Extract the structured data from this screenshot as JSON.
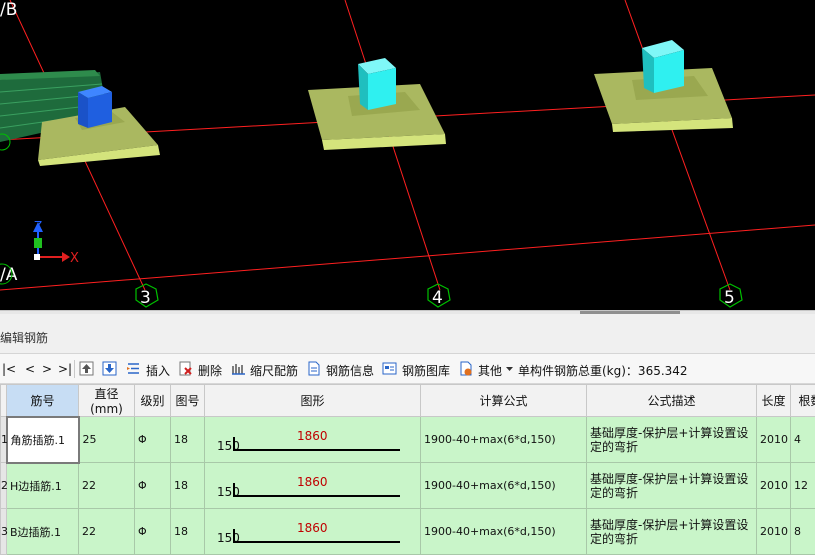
{
  "viewport": {
    "grid_labels": {
      "row_b": "/B",
      "row_a": "/A",
      "col_3": "3",
      "col_4": "4",
      "col_5": "5"
    },
    "axes": {
      "z": "Z",
      "x": "X"
    },
    "colors": {
      "background": "#000000",
      "grid_line": "#ff2020",
      "footing_top": "#aab860",
      "footing_side": "#cfe07a",
      "column": "#2ff0f0",
      "column_blue": "#1f5fe0",
      "beam": "#1e6b3c"
    }
  },
  "panel": {
    "title": "编辑钢筋"
  },
  "toolbar": {
    "nav_first": "|<",
    "nav_prev": "<",
    "nav_next": ">",
    "nav_last": ">|",
    "insert": "插入",
    "delete": "删除",
    "scale_rebar": "缩尺配筋",
    "rebar_info": "钢筋信息",
    "rebar_library": "钢筋图库",
    "other": "其他",
    "total_weight": "单构件钢筋总重(kg)：365.342"
  },
  "table": {
    "headers": [
      "筋号",
      "直径(mm)",
      "级别",
      "图号",
      "图形",
      "计算公式",
      "公式描述",
      "长度",
      "根数"
    ],
    "rows": [
      {
        "num": "1",
        "name": "角筋插筋.1",
        "diameter": "25",
        "grade": "Φ",
        "fig_no": "18",
        "shape_left": "150",
        "shape_mid": "1860",
        "formula": "1900-40+max(6*d,150)",
        "desc": "基础厚度-保护层+计算设置设定的弯折",
        "length": "2010",
        "count": "4"
      },
      {
        "num": "2",
        "name": "H边插筋.1",
        "diameter": "22",
        "grade": "Φ",
        "fig_no": "18",
        "shape_left": "150",
        "shape_mid": "1860",
        "formula": "1900-40+max(6*d,150)",
        "desc": "基础厚度-保护层+计算设置设定的弯折",
        "length": "2010",
        "count": "12"
      },
      {
        "num": "3",
        "name": "B边插筋.1",
        "diameter": "22",
        "grade": "Φ",
        "fig_no": "18",
        "shape_left": "150",
        "shape_mid": "1860",
        "formula": "1900-40+max(6*d,150)",
        "desc": "基础厚度-保护层+计算设置设定的弯折",
        "length": "2010",
        "count": "8"
      }
    ]
  }
}
